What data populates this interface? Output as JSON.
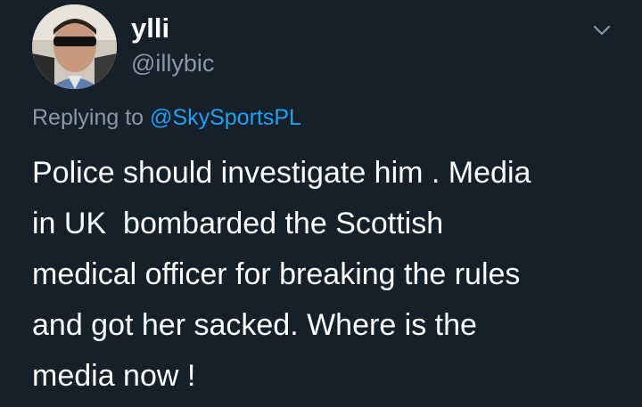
{
  "tweet": {
    "author": {
      "display_name": "ylli",
      "handle": "@illybic",
      "avatar_icon": "user-avatar"
    },
    "more_icon": "chevron-down-icon",
    "reply": {
      "prefix": "Replying to",
      "target": "@SkySportsPL"
    },
    "text_lines": [
      "Police should investigate him . Media",
      "in UK  bombarded the Scottish",
      "medical officer for breaking the rules",
      "and got her sacked. Where is the",
      "media now !"
    ]
  },
  "colors": {
    "background": "#15202b",
    "text": "#ffffff",
    "muted": "#8899a6",
    "link": "#1da1f2"
  }
}
